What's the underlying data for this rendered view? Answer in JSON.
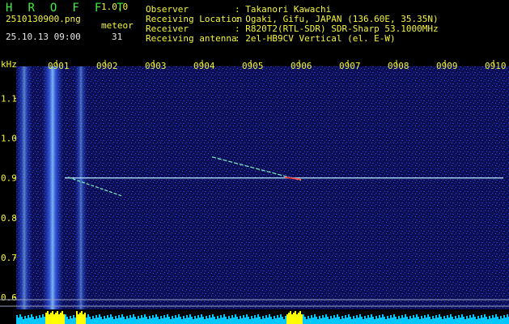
{
  "header": {
    "app_title": "H R O F F T",
    "app_version": "1.0.0",
    "file_name": "2510130900.png",
    "meteor_label": "meteor",
    "meteor_count": "31",
    "datetime": "25.10.13 09:00"
  },
  "station_info": [
    {
      "label": "Observer",
      "value": ": Takanori Kawachi"
    },
    {
      "label": "Receiving Location",
      "value": ": Ogaki, Gifu, JAPAN (136.60E, 35.35N)"
    },
    {
      "label": "Receiver",
      "value": ": R820T2(RTL-SDR) SDR-Sharp 53.1000MHz"
    },
    {
      "label": "Receiving antenna",
      "value": ": 2el-HB9CV Vertical (el. E-W)"
    }
  ],
  "spectrogram": {
    "y_unit_label": "kHz",
    "x_tick_labels": [
      "0901",
      "0902",
      "0903",
      "0904",
      "0905",
      "0906",
      "0907",
      "0908",
      "0909",
      "0910"
    ],
    "y_tick_labels": [
      "1.1",
      "1.0",
      "0.9",
      "0.8",
      "0.7",
      "0.6"
    ],
    "y_range_khz": [
      0.57,
      1.18
    ],
    "carrier_khz": 0.9,
    "colors": {
      "background": "#000000",
      "noise_floor": "#1a1f8c",
      "carrier": "#a8dcff",
      "axis_text": "#f5f53a",
      "power_bar": "#00c8ff",
      "power_peak": "#ffff00"
    }
  }
}
